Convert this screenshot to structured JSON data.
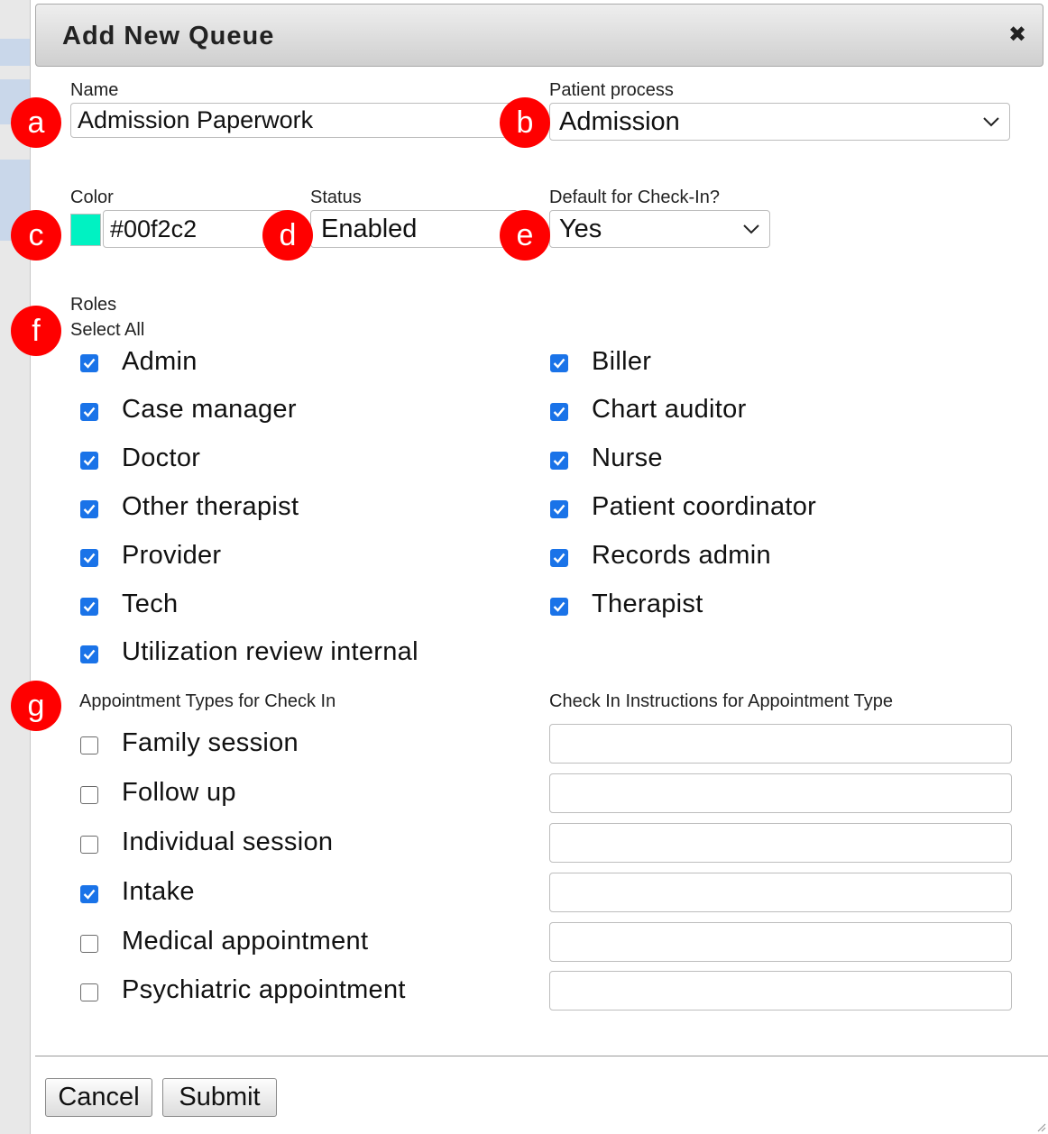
{
  "dialog": {
    "title": "Add New Queue",
    "close_glyph": "✖"
  },
  "form": {
    "name_label": "Name",
    "name_value": "Admission Paperwork",
    "process_label": "Patient process",
    "process_value": "Admission",
    "color_label": "Color",
    "color_value": "#00f2c2",
    "status_label": "Status",
    "status_value": "Enabled",
    "default_label": "Default for Check-In?",
    "default_value": "Yes"
  },
  "markers": [
    "a",
    "b",
    "c",
    "d",
    "e",
    "f",
    "g"
  ],
  "roles": {
    "label": "Roles",
    "select_all": "Select All",
    "items": [
      {
        "label": "Admin",
        "checked": true
      },
      {
        "label": "Biller",
        "checked": true
      },
      {
        "label": "Case manager",
        "checked": true
      },
      {
        "label": "Chart auditor",
        "checked": true
      },
      {
        "label": "Doctor",
        "checked": true
      },
      {
        "label": "Nurse",
        "checked": true
      },
      {
        "label": "Other therapist",
        "checked": true
      },
      {
        "label": "Patient coordinator",
        "checked": true
      },
      {
        "label": "Provider",
        "checked": true
      },
      {
        "label": "Records admin",
        "checked": true
      },
      {
        "label": "Tech",
        "checked": true
      },
      {
        "label": "Therapist",
        "checked": true
      },
      {
        "label": "Utilization review internal",
        "checked": true
      }
    ]
  },
  "appointments": {
    "types_header": "Appointment Types for Check In",
    "instructions_header": "Check In Instructions for Appointment Type",
    "items": [
      {
        "label": "Family session",
        "checked": false,
        "instructions": ""
      },
      {
        "label": "Follow up",
        "checked": false,
        "instructions": ""
      },
      {
        "label": "Individual session",
        "checked": false,
        "instructions": ""
      },
      {
        "label": "Intake",
        "checked": true,
        "instructions": ""
      },
      {
        "label": "Medical appointment",
        "checked": false,
        "instructions": ""
      },
      {
        "label": "Psychiatric appointment",
        "checked": false,
        "instructions": ""
      }
    ]
  },
  "footer": {
    "cancel_label": "Cancel",
    "submit_label": "Submit"
  },
  "colors": {
    "marker": "#ff0000",
    "checkbox": "#1a73e8",
    "swatch": "#00f2c2"
  }
}
